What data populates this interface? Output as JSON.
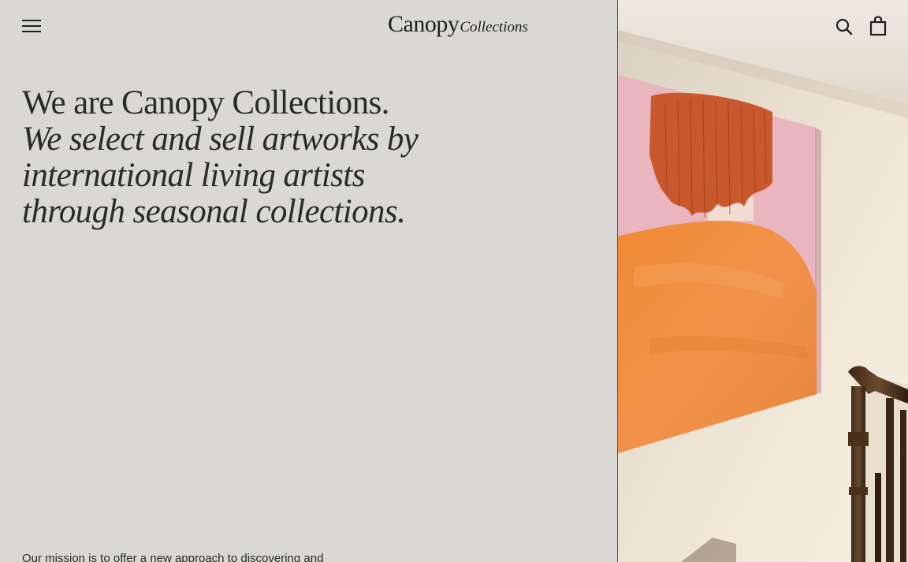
{
  "header": {
    "menu_icon": "hamburger-menu-icon",
    "logo": {
      "main": "Canopy",
      "sub": "Collections"
    },
    "search_icon": "search-icon",
    "cart_icon": "shopping-bag-icon"
  },
  "hero": {
    "line1": "We are Canopy Collections.",
    "line2": "We select and sell artworks by",
    "line3": "international living artists",
    "line4": "through seasonal collections."
  },
  "mission": {
    "text": "Our mission is to offer a new approach to discovering and"
  },
  "colors": {
    "background": "#d9d8d5",
    "text": "#2a2a28",
    "artwork_orange": "#ef8a3c",
    "artwork_pink": "#e7b7bd"
  }
}
